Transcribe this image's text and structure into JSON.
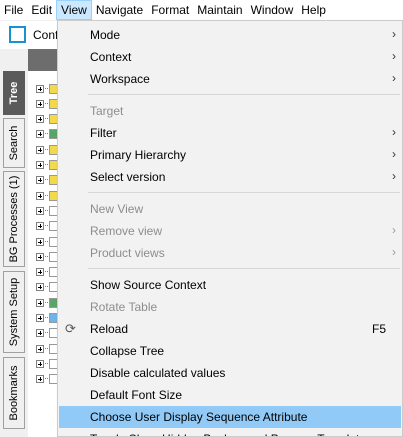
{
  "menubar": {
    "items": [
      {
        "label": "File"
      },
      {
        "label": "Edit"
      },
      {
        "label": "View"
      },
      {
        "label": "Navigate"
      },
      {
        "label": "Format"
      },
      {
        "label": "Maintain"
      },
      {
        "label": "Window"
      },
      {
        "label": "Help"
      }
    ],
    "active": "View"
  },
  "toolbar": {
    "label": "Conf"
  },
  "side_tabs": [
    {
      "label": "Tree",
      "active": true
    },
    {
      "label": "Search"
    },
    {
      "label": "BG Processes (1)"
    },
    {
      "label": "System Setup"
    },
    {
      "label": "Bookmarks"
    }
  ],
  "menu": {
    "groups": [
      [
        {
          "label": "Mode",
          "submenu": true,
          "enabled": true
        },
        {
          "label": "Context",
          "submenu": true,
          "enabled": true
        },
        {
          "label": "Workspace",
          "submenu": true,
          "enabled": true
        }
      ],
      [
        {
          "label": "Target",
          "submenu": false,
          "enabled": false
        },
        {
          "label": "Filter",
          "submenu": true,
          "enabled": true
        },
        {
          "label": "Primary Hierarchy",
          "submenu": true,
          "enabled": true
        },
        {
          "label": "Select version",
          "submenu": true,
          "enabled": true
        }
      ],
      [
        {
          "label": "New View",
          "submenu": false,
          "enabled": false
        },
        {
          "label": "Remove view",
          "submenu": true,
          "enabled": false
        },
        {
          "label": "Product views",
          "submenu": true,
          "enabled": false
        }
      ],
      [
        {
          "label": "Show Source Context",
          "enabled": true
        },
        {
          "label": "Rotate Table",
          "enabled": false
        },
        {
          "label": "Reload",
          "enabled": true,
          "shortcut": "F5",
          "icon": "reload-icon"
        },
        {
          "label": "Collapse Tree",
          "enabled": true
        },
        {
          "label": "Disable calculated values",
          "enabled": true
        },
        {
          "label": "Default Font Size",
          "enabled": true
        },
        {
          "label": "Choose User Display Sequence Attribute",
          "enabled": true,
          "highlighted": true
        },
        {
          "label": "Toggle Show Hidden Background Process Templates",
          "enabled": true
        }
      ]
    ]
  },
  "colors": {
    "highlight": "#91c9f7",
    "menubar_active": "#cce8ff",
    "checkbox_border": "#1a8fd1",
    "tree_header": "#6d6d6d"
  }
}
